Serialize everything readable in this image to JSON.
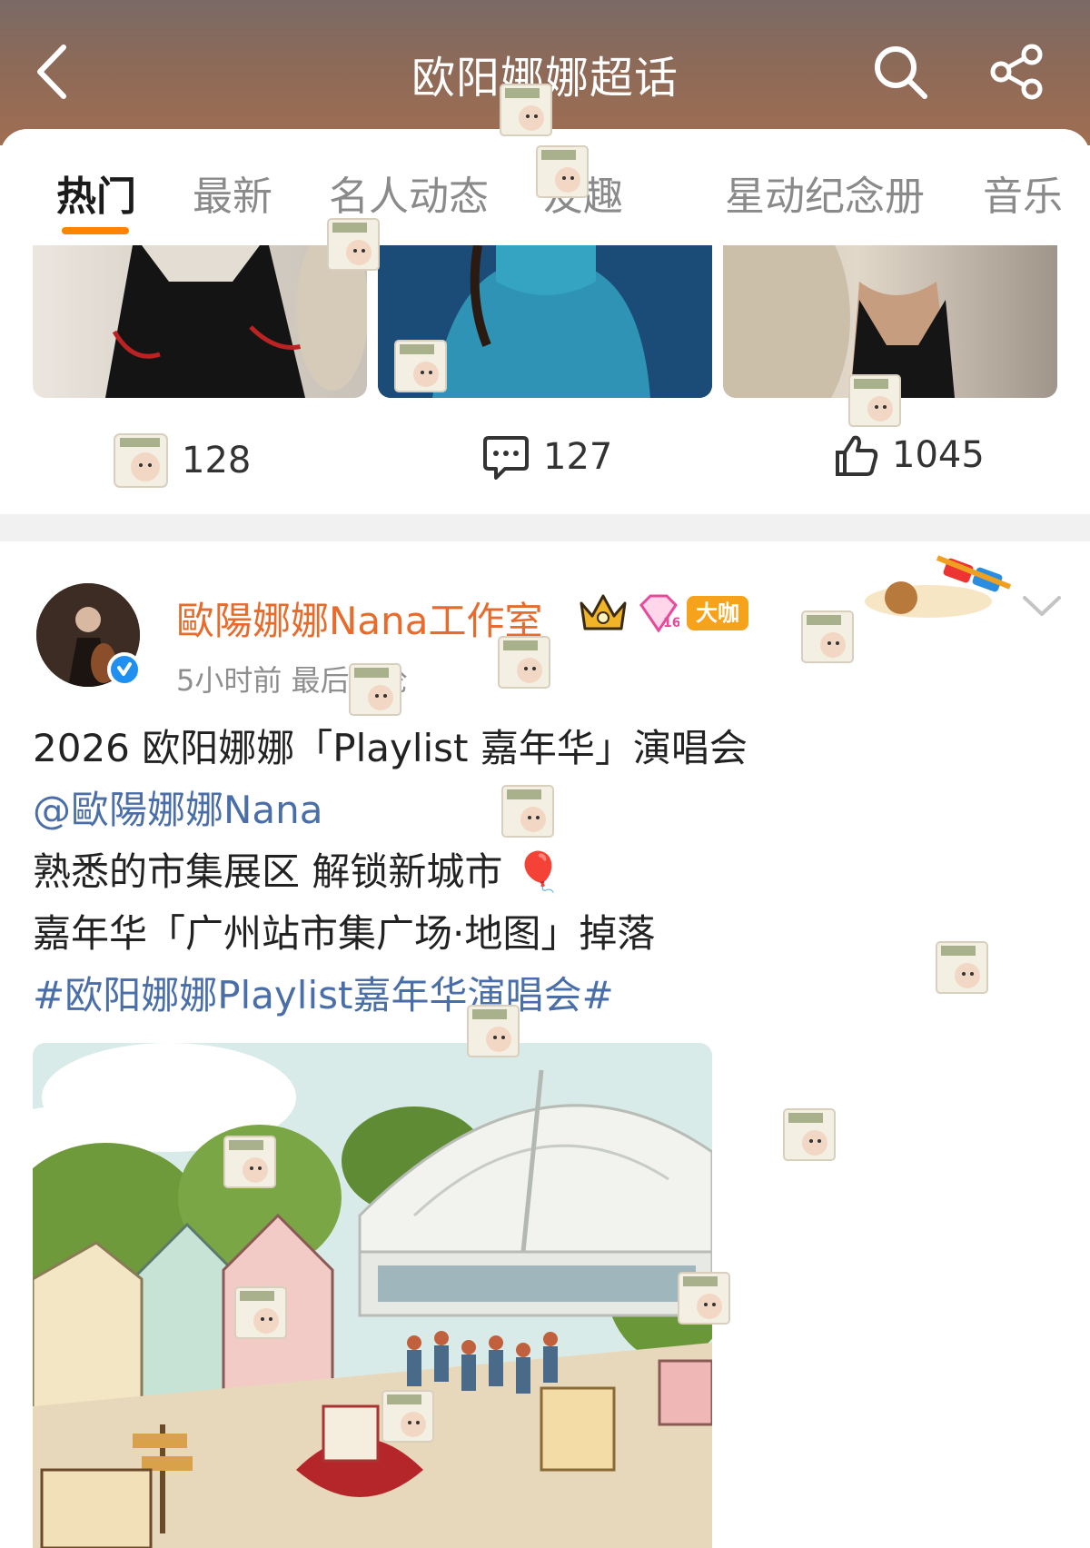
{
  "header": {
    "title": "欧阳娜娜超话",
    "back_icon": "chevron-left-icon",
    "search_icon": "search-icon",
    "share_icon": "share-icon"
  },
  "tabs": [
    {
      "label": "热门",
      "active": true
    },
    {
      "label": "最新",
      "active": false
    },
    {
      "label": "名人动态",
      "active": false
    },
    {
      "label": "友趣",
      "active": false
    },
    {
      "label": "星动纪念册",
      "active": false
    },
    {
      "label": "音乐",
      "active": false
    }
  ],
  "prev_post": {
    "actions": {
      "repost_count": "128",
      "comment_count": "127",
      "like_count": "1045"
    }
  },
  "post": {
    "author": "歐陽娜娜Nana工作室",
    "vip_badge": "大咖",
    "level_badge": "16",
    "meta": "5小时前 最后评论",
    "lines": {
      "line1": "2026 欧阳娜娜「Playlist 嘉年华」演唱会",
      "mention": "@歐陽娜娜Nana",
      "line3": "熟悉的市集展区 解锁新城市 🎈",
      "line4": "嘉年华「广州站市集广场·地图」掉落",
      "hashtag": "#欧阳娜娜Playlist嘉年华演唱会#"
    }
  },
  "colors": {
    "accent": "#ff8200",
    "author_name": "#e86b2b",
    "link": "#4a6ea8",
    "verified": "#1f8ff0",
    "header_top": "#7a6a66",
    "header_bottom": "#a06e52"
  }
}
